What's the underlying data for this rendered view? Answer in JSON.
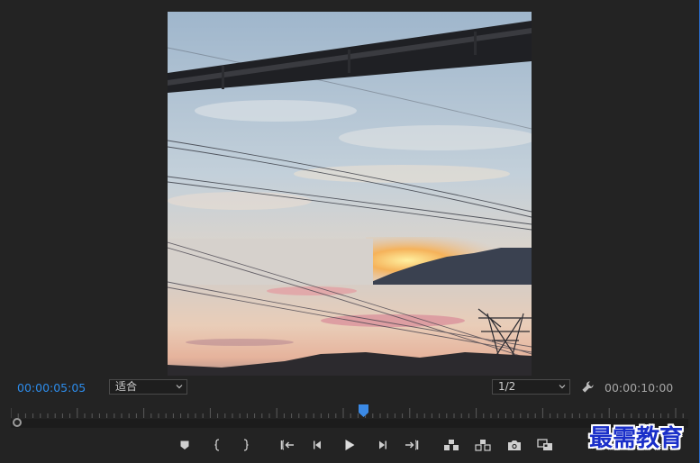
{
  "timecode": {
    "current": "00:00:05:05",
    "duration": "00:00:10:00"
  },
  "zoom": {
    "selected": "适合"
  },
  "resolution": {
    "selected": "1/2"
  },
  "playback": {
    "position_fraction": 0.52
  },
  "controls": [
    {
      "name": "add-marker-button",
      "icon": "marker-icon"
    },
    {
      "name": "mark-in-button",
      "icon": "mark-in-icon"
    },
    {
      "name": "mark-out-button",
      "icon": "mark-out-icon"
    },
    {
      "name": "go-to-in-button",
      "icon": "go-to-in-icon"
    },
    {
      "name": "step-back-button",
      "icon": "step-back-icon"
    },
    {
      "name": "play-button",
      "icon": "play-icon"
    },
    {
      "name": "step-forward-button",
      "icon": "step-forward-icon"
    },
    {
      "name": "go-to-out-button",
      "icon": "go-to-out-icon"
    },
    {
      "name": "lift-button",
      "icon": "lift-icon"
    },
    {
      "name": "extract-button",
      "icon": "extract-icon"
    },
    {
      "name": "export-frame-button",
      "icon": "camera-icon"
    },
    {
      "name": "comparison-view-button",
      "icon": "comparison-icon"
    }
  ],
  "watermark": {
    "text": "最需教育"
  },
  "colors": {
    "accent": "#2d8ceb",
    "background": "#232323",
    "watermark": "#1a2fc9"
  }
}
